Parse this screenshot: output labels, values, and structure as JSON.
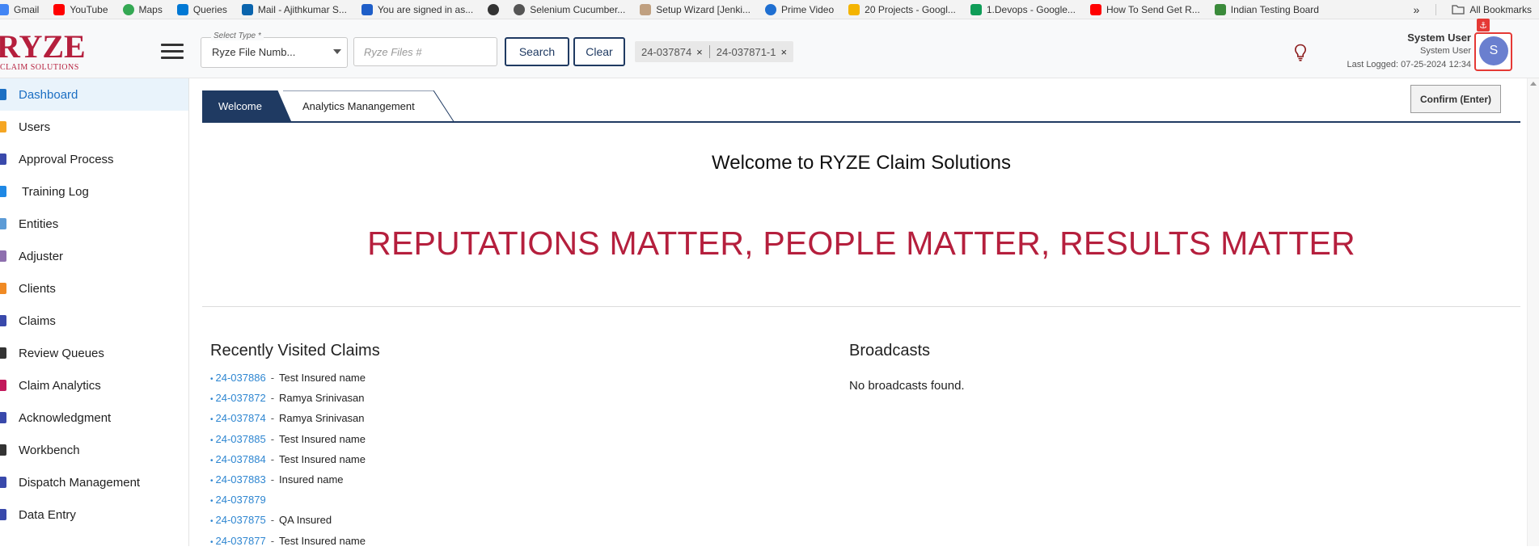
{
  "bookmarks": [
    {
      "label": "Gmail",
      "icon": "gmail-icon",
      "color": "#4285f4"
    },
    {
      "label": "YouTube",
      "icon": "youtube-icon",
      "color": "#ff0000"
    },
    {
      "label": "Maps",
      "icon": "maps-icon",
      "color": "#34a853"
    },
    {
      "label": "Queries",
      "icon": "azure-devops-icon",
      "color": "#0078d4"
    },
    {
      "label": "Mail - Ajithkumar S...",
      "icon": "outlook-icon",
      "color": "#0a64ad"
    },
    {
      "label": "You are signed in as...",
      "icon": "s-square-icon",
      "color": "#1e5ec8"
    },
    {
      "label": "",
      "icon": "globe-icon",
      "color": "#333333"
    },
    {
      "label": "Selenium Cucumber...",
      "icon": "openai-icon",
      "color": "#555555"
    },
    {
      "label": "Setup Wizard [Jenki...",
      "icon": "jenkins-icon",
      "color": "#c0a080"
    },
    {
      "label": "Prime Video",
      "icon": "prime-video-icon",
      "color": "#1f6fd1"
    },
    {
      "label": "20 Projects - Googl...",
      "icon": "google-drive-icon",
      "color": "#f4b400"
    },
    {
      "label": "1.Devops - Google...",
      "icon": "google-drive-icon",
      "color": "#0f9d58"
    },
    {
      "label": "How To Send Get R...",
      "icon": "youtube-icon",
      "color": "#ff0000"
    },
    {
      "label": "Indian Testing Board",
      "icon": "itb-icon",
      "color": "#3a8a3a"
    }
  ],
  "bookmarks_overflow": "»",
  "all_bookmarks": "All Bookmarks",
  "logo": {
    "main": "RYZE",
    "sub": "CLAIM SOLUTIONS"
  },
  "header": {
    "select_label": "Select Type *",
    "select_value": "Ryze File Numb...",
    "files_placeholder": "Ryze Files #",
    "search_label": "Search",
    "clear_label": "Clear",
    "tags": [
      "24-037874",
      "24-037871-1"
    ],
    "tag_close": "×"
  },
  "user": {
    "name": "System User",
    "role": "System User",
    "last_logged": "Last Logged: 07-25-2024 12:34",
    "avatar_letter": "S"
  },
  "sidebar": {
    "items": [
      {
        "label": "Dashboard",
        "icon": "dashboard-icon",
        "color": "#1c6fc3",
        "active": true
      },
      {
        "label": "Users",
        "icon": "users-icon",
        "color": "#f5a623"
      },
      {
        "label": "Approval Process",
        "icon": "approval-icon",
        "color": "#3949ab"
      },
      {
        "label": "Training Log",
        "icon": "training-icon",
        "color": "#1e88e5"
      },
      {
        "label": "Entities",
        "icon": "entities-icon",
        "color": "#5c9bd6"
      },
      {
        "label": "Adjuster",
        "icon": "adjuster-icon",
        "color": "#8e6fae"
      },
      {
        "label": "Clients",
        "icon": "clients-icon",
        "color": "#f08a24"
      },
      {
        "label": "Claims",
        "icon": "claims-icon",
        "color": "#3949ab"
      },
      {
        "label": "Review Queues",
        "icon": "review-queues-icon",
        "color": "#333333"
      },
      {
        "label": "Claim Analytics",
        "icon": "claim-analytics-icon",
        "color": "#c2185b"
      },
      {
        "label": "Acknowledgment",
        "icon": "acknowledgment-icon",
        "color": "#3949ab"
      },
      {
        "label": "Workbench",
        "icon": "workbench-icon",
        "color": "#333333"
      },
      {
        "label": "Dispatch Management",
        "icon": "dispatch-icon",
        "color": "#3949ab"
      },
      {
        "label": "Data Entry",
        "icon": "data-entry-icon",
        "color": "#3949ab"
      }
    ]
  },
  "tabs": {
    "welcome": "Welcome",
    "analytics": "Analytics Manangement"
  },
  "confirm_label": "Confirm (Enter)",
  "main": {
    "welcome_title": "Welcome to RYZE Claim Solutions",
    "slogan": "REPUTATIONS MATTER, PEOPLE MATTER, RESULTS MATTER",
    "recent_title": "Recently Visited Claims",
    "broadcasts_title": "Broadcasts",
    "no_broadcasts": "No broadcasts found.",
    "recent_claims": [
      {
        "id": "24-037886",
        "name": "Test Insured name"
      },
      {
        "id": "24-037872",
        "name": "Ramya Srinivasan"
      },
      {
        "id": "24-037874",
        "name": "Ramya Srinivasan"
      },
      {
        "id": "24-037885",
        "name": "Test Insured name"
      },
      {
        "id": "24-037884",
        "name": "Test Insured name"
      },
      {
        "id": "24-037883",
        "name": "Insured name"
      },
      {
        "id": "24-037879",
        "name": ""
      },
      {
        "id": "24-037875",
        "name": "QA Insured"
      },
      {
        "id": "24-037877",
        "name": "Test Insured name"
      }
    ]
  },
  "colors": {
    "brand": "#b51f3d",
    "navy": "#1f3a62",
    "link": "#2e86d1"
  }
}
